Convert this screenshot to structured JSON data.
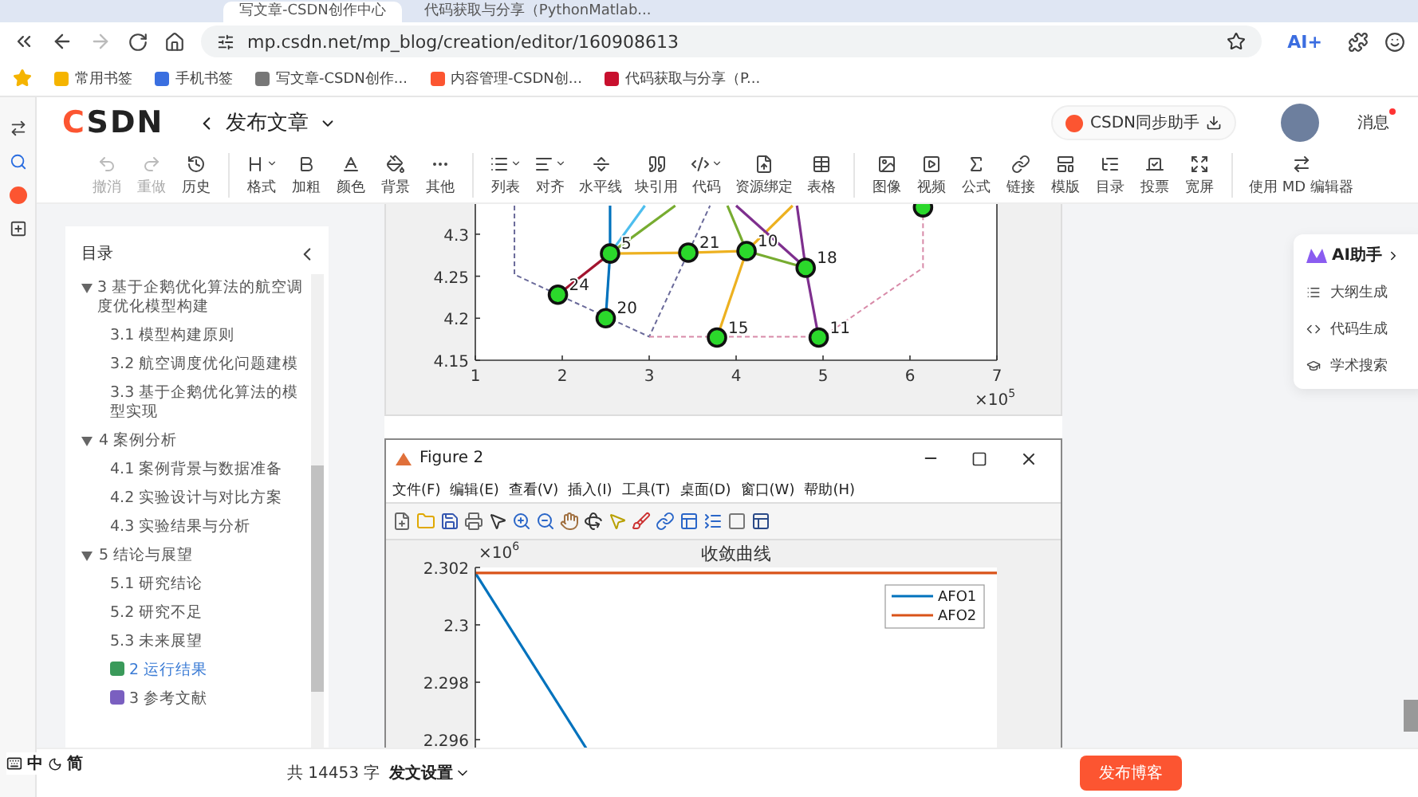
{
  "browser": {
    "tabs": [
      {
        "label": "写文章-CSDN创作中心",
        "selected": true
      },
      {
        "label": "代码获取与分享（PythonMatlab...",
        "selected": false
      }
    ],
    "url": "mp.csdn.net/mp_blog/creation/editor/160908613",
    "ai_button": "AI+",
    "bookmarks": [
      {
        "label": "常用书签",
        "kind": "folder"
      },
      {
        "label": "手机书签",
        "kind": "phone"
      },
      {
        "label": "写文章-CSDN创作...",
        "kind": "page"
      },
      {
        "label": "内容管理-CSDN创...",
        "kind": "brand"
      },
      {
        "label": "代码获取与分享（P...",
        "kind": "brand2"
      }
    ]
  },
  "header": {
    "logo": "CSDN",
    "title": "发布文章",
    "sync_button": "CSDN同步助手",
    "messages": "消息",
    "has_unread": true
  },
  "toolbar": {
    "groups": [
      [
        {
          "label": "撤消",
          "disabled": true,
          "dropdown": false
        },
        {
          "label": "重做",
          "disabled": true,
          "dropdown": false
        },
        {
          "label": "历史",
          "disabled": false,
          "dropdown": false
        }
      ],
      [
        {
          "label": "格式",
          "disabled": false,
          "dropdown": true
        },
        {
          "label": "加粗",
          "disabled": false,
          "dropdown": false
        },
        {
          "label": "颜色",
          "disabled": false,
          "dropdown": false
        },
        {
          "label": "背景",
          "disabled": false,
          "dropdown": false
        },
        {
          "label": "其他",
          "disabled": false,
          "dropdown": false
        }
      ],
      [
        {
          "label": "列表",
          "disabled": false,
          "dropdown": true
        },
        {
          "label": "对齐",
          "disabled": false,
          "dropdown": true
        },
        {
          "label": "水平线",
          "disabled": false,
          "dropdown": false
        },
        {
          "label": "块引用",
          "disabled": false,
          "dropdown": false
        },
        {
          "label": "代码",
          "disabled": false,
          "dropdown": true
        },
        {
          "label": "资源绑定",
          "disabled": false,
          "dropdown": false
        },
        {
          "label": "表格",
          "disabled": false,
          "dropdown": false
        }
      ],
      [
        {
          "label": "图像",
          "disabled": false,
          "dropdown": false
        },
        {
          "label": "视频",
          "disabled": false,
          "dropdown": false
        },
        {
          "label": "公式",
          "disabled": false,
          "dropdown": false
        },
        {
          "label": "链接",
          "disabled": false,
          "dropdown": false
        },
        {
          "label": "模版",
          "disabled": false,
          "dropdown": false
        },
        {
          "label": "目录",
          "disabled": false,
          "dropdown": false
        },
        {
          "label": "投票",
          "disabled": false,
          "dropdown": false
        },
        {
          "label": "宽屏",
          "disabled": false,
          "dropdown": false
        }
      ],
      [
        {
          "label": "使用 MD 编辑器",
          "disabled": false,
          "dropdown": false
        }
      ]
    ]
  },
  "toc": {
    "title": "目录",
    "items": [
      {
        "label": "3 基于企鹅优化算法的航空调度优化模型构建",
        "kind": "section",
        "expanded": true,
        "selected": false,
        "children": [
          {
            "label": "3.1 模型构建原则",
            "selected": false
          },
          {
            "label": "3.2 航空调度优化问题建模",
            "selected": false
          },
          {
            "label": "3.3 基于企鹅优化算法的模型实现",
            "selected": false
          }
        ]
      },
      {
        "label": "4 案例分析",
        "kind": "section",
        "expanded": true,
        "selected": false,
        "children": [
          {
            "label": "4.1 案例背景与数据准备",
            "selected": false
          },
          {
            "label": "4.2 实验设计与对比方案",
            "selected": false
          },
          {
            "label": "4.3 实验结果与分析",
            "selected": false
          }
        ]
      },
      {
        "label": "5 结论与展望",
        "kind": "section",
        "expanded": true,
        "selected": false,
        "children": [
          {
            "label": "5.1 研究结论",
            "selected": false
          },
          {
            "label": "5.2 研究不足",
            "selected": false
          },
          {
            "label": "5.3 未来展望",
            "selected": false
          }
        ]
      },
      {
        "label": "2 运行结果",
        "kind": "cubes",
        "selected": true
      },
      {
        "label": "3 参考文献",
        "kind": "writing",
        "selected": false
      }
    ]
  },
  "figure1": {
    "x_multiplier": {
      "base": "×10",
      "power": "5"
    },
    "chart_data": {
      "type": "scatter",
      "xlim": [
        1,
        7
      ],
      "ylim": [
        4.15,
        4.334
      ],
      "xticks": [
        {
          "value": 1,
          "label": "1"
        },
        {
          "value": 2,
          "label": "2"
        },
        {
          "value": 3,
          "label": "3"
        },
        {
          "value": 4,
          "label": "4"
        },
        {
          "value": 5,
          "label": "5"
        },
        {
          "value": 6,
          "label": "6"
        },
        {
          "value": 7,
          "label": "7"
        }
      ],
      "yticks": [
        {
          "value": 4.15,
          "label": "4.15"
        },
        {
          "value": 4.2,
          "label": "4.2"
        },
        {
          "value": 4.25,
          "label": "4.25"
        },
        {
          "value": 4.3,
          "label": "4.3"
        }
      ],
      "x": [
        1.95,
        2.55,
        2.5,
        3.45,
        4.12,
        4.8,
        3.78,
        4.95,
        6.15
      ],
      "values": [
        4.228,
        4.277,
        4.2,
        4.278,
        4.28,
        4.26,
        4.177,
        4.177,
        4.332
      ],
      "annotations": [
        {
          "text": "24",
          "x": 1.95,
          "y": 4.228
        },
        {
          "text": "5",
          "x": 2.55,
          "y": 4.277
        },
        {
          "text": "20",
          "x": 2.5,
          "y": 4.2
        },
        {
          "text": "21",
          "x": 3.45,
          "y": 4.278
        },
        {
          "text": "10",
          "x": 4.12,
          "y": 4.28
        },
        {
          "text": "18",
          "x": 4.8,
          "y": 4.26
        },
        {
          "text": "15",
          "x": 3.78,
          "y": 4.177
        },
        {
          "text": "11",
          "x": 4.95,
          "y": 4.177
        }
      ]
    }
  },
  "figure2": {
    "title": "Figure 2",
    "menu": [
      "文件(F)",
      "编辑(E)",
      "查看(V)",
      "插入(I)",
      "工具(T)",
      "桌面(D)",
      "窗口(W)",
      "帮助(H)"
    ],
    "y_multiplier": {
      "base": "×10",
      "power": "6"
    },
    "plot_title": "收敛曲线",
    "plot": {
      "y_tick_labels": [
        "2.302",
        "2.3",
        "2.298",
        "2.296"
      ],
      "legend": [
        {
          "name": "AFO1",
          "color": "#0072bd"
        },
        {
          "name": "AFO2",
          "color": "#d95319"
        }
      ]
    }
  },
  "ai_panel": {
    "title": "AI助手",
    "items": [
      "大纲生成",
      "代码生成",
      "学术搜索"
    ]
  },
  "footer": {
    "word_count": "共 14453 字",
    "settings": "发文设置",
    "publish": "发布博客"
  },
  "ime": {
    "mode": "中",
    "script": "简"
  }
}
